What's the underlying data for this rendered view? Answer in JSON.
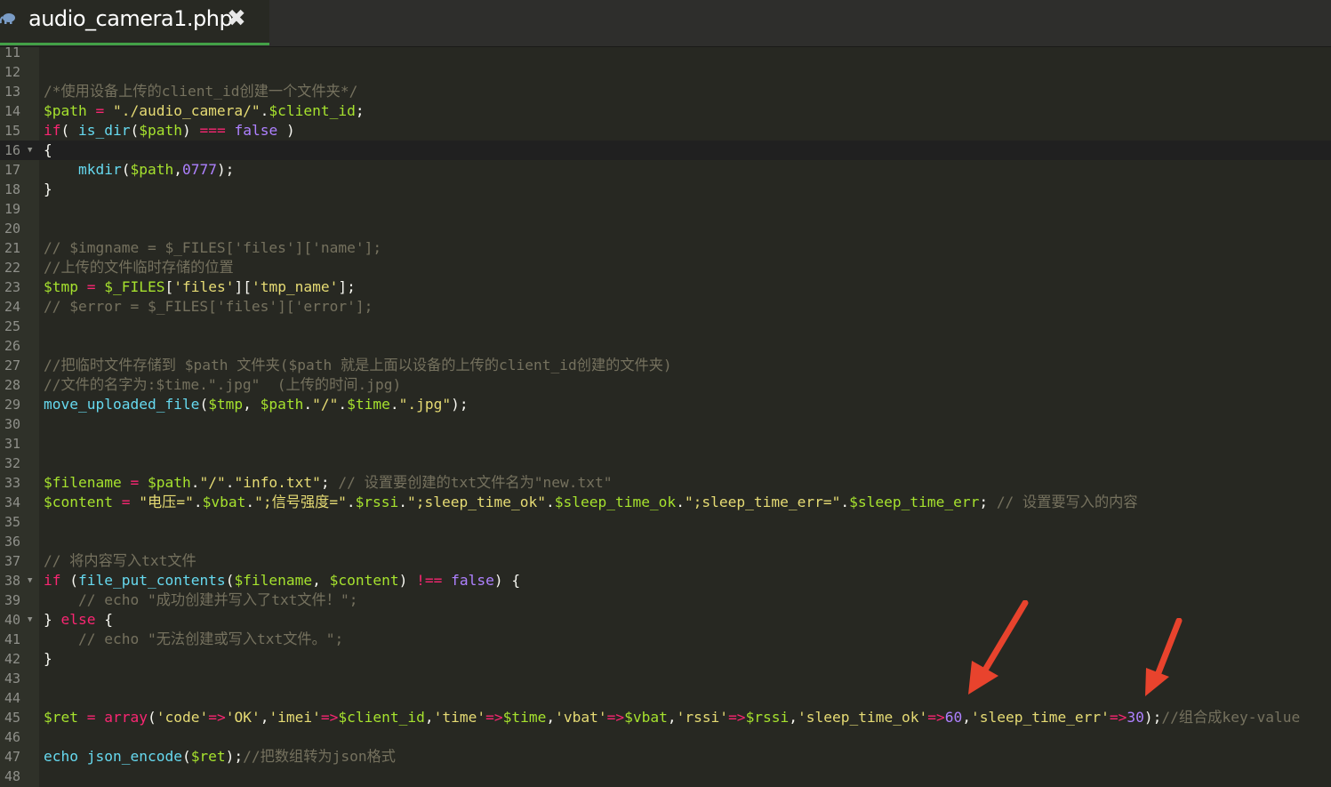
{
  "tab": {
    "title": "audio_camera1.php",
    "close_glyph": "✖",
    "icon": "php-elephant-icon"
  },
  "colors": {
    "background": "#272822",
    "gutter": "#2f3129",
    "comment": "#75715e",
    "variable": "#a6e22e",
    "string": "#e6db74",
    "keyword": "#f92672",
    "number": "#ae81ff",
    "function": "#66d9ef",
    "arrow": "#e8432d",
    "tab_underline": "#43a047"
  },
  "lines": [
    {
      "n": "11",
      "t": []
    },
    {
      "n": "12",
      "t": []
    },
    {
      "n": "13",
      "t": [
        {
          "c": "cm",
          "s": "/*使用设备上传的client_id创建一个文件夹*/"
        }
      ]
    },
    {
      "n": "14",
      "t": [
        {
          "c": "va",
          "s": "$path"
        },
        {
          "c": "pl",
          "s": " "
        },
        {
          "c": "op",
          "s": "="
        },
        {
          "c": "pl",
          "s": " "
        },
        {
          "c": "st",
          "s": "\"./audio_camera/\""
        },
        {
          "c": "pl",
          "s": "."
        },
        {
          "c": "va",
          "s": "$client_id"
        },
        {
          "c": "pl",
          "s": ";"
        }
      ]
    },
    {
      "n": "15",
      "t": [
        {
          "c": "kw",
          "s": "if"
        },
        {
          "c": "pl",
          "s": "( "
        },
        {
          "c": "fn",
          "s": "is_dir"
        },
        {
          "c": "pl",
          "s": "("
        },
        {
          "c": "va",
          "s": "$path"
        },
        {
          "c": "pl",
          "s": ") "
        },
        {
          "c": "op",
          "s": "==="
        },
        {
          "c": "pl",
          "s": " "
        },
        {
          "c": "bo",
          "s": "false"
        },
        {
          "c": "pl",
          "s": " )"
        }
      ]
    },
    {
      "n": "16",
      "fold": true,
      "active": true,
      "t": [
        {
          "c": "pl",
          "s": "{"
        }
      ]
    },
    {
      "n": "17",
      "t": [
        {
          "c": "pl",
          "s": "    "
        },
        {
          "c": "fn",
          "s": "mkdir"
        },
        {
          "c": "pl",
          "s": "("
        },
        {
          "c": "va",
          "s": "$path"
        },
        {
          "c": "pl",
          "s": ","
        },
        {
          "c": "nu",
          "s": "0777"
        },
        {
          "c": "pl",
          "s": ");"
        }
      ]
    },
    {
      "n": "18",
      "t": [
        {
          "c": "pl",
          "s": "}"
        }
      ]
    },
    {
      "n": "19",
      "t": []
    },
    {
      "n": "20",
      "t": []
    },
    {
      "n": "21",
      "t": [
        {
          "c": "cm",
          "s": "// $imgname = $_FILES['files']['name'];"
        }
      ]
    },
    {
      "n": "22",
      "t": [
        {
          "c": "cm",
          "s": "//上传的文件临时存储的位置"
        }
      ]
    },
    {
      "n": "23",
      "t": [
        {
          "c": "va",
          "s": "$tmp"
        },
        {
          "c": "pl",
          "s": " "
        },
        {
          "c": "op",
          "s": "="
        },
        {
          "c": "pl",
          "s": " "
        },
        {
          "c": "va",
          "s": "$_FILES"
        },
        {
          "c": "pl",
          "s": "["
        },
        {
          "c": "st",
          "s": "'files'"
        },
        {
          "c": "pl",
          "s": "]["
        },
        {
          "c": "st",
          "s": "'tmp_name'"
        },
        {
          "c": "pl",
          "s": "];"
        }
      ]
    },
    {
      "n": "24",
      "t": [
        {
          "c": "cm",
          "s": "// $error = $_FILES['files']['error'];"
        }
      ]
    },
    {
      "n": "25",
      "t": []
    },
    {
      "n": "26",
      "t": []
    },
    {
      "n": "27",
      "t": [
        {
          "c": "cm",
          "s": "//把临时文件存储到 $path 文件夹($path 就是上面以设备的上传的client_id创建的文件夹)"
        }
      ]
    },
    {
      "n": "28",
      "t": [
        {
          "c": "cm",
          "s": "//文件的名字为:$time.\".jpg\"  (上传的时间.jpg)"
        }
      ]
    },
    {
      "n": "29",
      "t": [
        {
          "c": "fn",
          "s": "move_uploaded_file"
        },
        {
          "c": "pl",
          "s": "("
        },
        {
          "c": "va",
          "s": "$tmp"
        },
        {
          "c": "pl",
          "s": ", "
        },
        {
          "c": "va",
          "s": "$path"
        },
        {
          "c": "pl",
          "s": "."
        },
        {
          "c": "st",
          "s": "\"/\""
        },
        {
          "c": "pl",
          "s": "."
        },
        {
          "c": "va",
          "s": "$time"
        },
        {
          "c": "pl",
          "s": "."
        },
        {
          "c": "st",
          "s": "\".jpg\""
        },
        {
          "c": "pl",
          "s": ");"
        }
      ]
    },
    {
      "n": "30",
      "t": []
    },
    {
      "n": "31",
      "t": []
    },
    {
      "n": "32",
      "t": []
    },
    {
      "n": "33",
      "t": [
        {
          "c": "va",
          "s": "$filename"
        },
        {
          "c": "pl",
          "s": " "
        },
        {
          "c": "op",
          "s": "="
        },
        {
          "c": "pl",
          "s": " "
        },
        {
          "c": "va",
          "s": "$path"
        },
        {
          "c": "pl",
          "s": "."
        },
        {
          "c": "st",
          "s": "\"/\""
        },
        {
          "c": "pl",
          "s": "."
        },
        {
          "c": "st",
          "s": "\"info.txt\""
        },
        {
          "c": "pl",
          "s": "; "
        },
        {
          "c": "cm",
          "s": "// 设置要创建的txt文件名为\"new.txt\""
        }
      ]
    },
    {
      "n": "34",
      "t": [
        {
          "c": "va",
          "s": "$content"
        },
        {
          "c": "pl",
          "s": " "
        },
        {
          "c": "op",
          "s": "="
        },
        {
          "c": "pl",
          "s": " "
        },
        {
          "c": "st",
          "s": "\"电压=\""
        },
        {
          "c": "pl",
          "s": "."
        },
        {
          "c": "va",
          "s": "$vbat"
        },
        {
          "c": "pl",
          "s": "."
        },
        {
          "c": "st",
          "s": "\";信号强度=\""
        },
        {
          "c": "pl",
          "s": "."
        },
        {
          "c": "va",
          "s": "$rssi"
        },
        {
          "c": "pl",
          "s": "."
        },
        {
          "c": "st",
          "s": "\";sleep_time_ok\""
        },
        {
          "c": "pl",
          "s": "."
        },
        {
          "c": "va",
          "s": "$sleep_time_ok"
        },
        {
          "c": "pl",
          "s": "."
        },
        {
          "c": "st",
          "s": "\";sleep_time_err=\""
        },
        {
          "c": "pl",
          "s": "."
        },
        {
          "c": "va",
          "s": "$sleep_time_err"
        },
        {
          "c": "pl",
          "s": "; "
        },
        {
          "c": "cm",
          "s": "// 设置要写入的内容"
        }
      ]
    },
    {
      "n": "35",
      "t": []
    },
    {
      "n": "36",
      "t": []
    },
    {
      "n": "37",
      "t": [
        {
          "c": "cm",
          "s": "// 将内容写入txt文件"
        }
      ]
    },
    {
      "n": "38",
      "fold": true,
      "t": [
        {
          "c": "kw",
          "s": "if"
        },
        {
          "c": "pl",
          "s": " ("
        },
        {
          "c": "fn",
          "s": "file_put_contents"
        },
        {
          "c": "pl",
          "s": "("
        },
        {
          "c": "va",
          "s": "$filename"
        },
        {
          "c": "pl",
          "s": ", "
        },
        {
          "c": "va",
          "s": "$content"
        },
        {
          "c": "pl",
          "s": ") "
        },
        {
          "c": "op",
          "s": "!=="
        },
        {
          "c": "pl",
          "s": " "
        },
        {
          "c": "bo",
          "s": "false"
        },
        {
          "c": "pl",
          "s": ") {"
        }
      ]
    },
    {
      "n": "39",
      "t": [
        {
          "c": "pl",
          "s": "    "
        },
        {
          "c": "cm",
          "s": "// echo \"成功创建并写入了txt文件！\";"
        }
      ]
    },
    {
      "n": "40",
      "fold": true,
      "t": [
        {
          "c": "pl",
          "s": "} "
        },
        {
          "c": "kw",
          "s": "else"
        },
        {
          "c": "pl",
          "s": " {"
        }
      ]
    },
    {
      "n": "41",
      "t": [
        {
          "c": "pl",
          "s": "    "
        },
        {
          "c": "cm",
          "s": "// echo \"无法创建或写入txt文件。\";"
        }
      ]
    },
    {
      "n": "42",
      "t": [
        {
          "c": "pl",
          "s": "}"
        }
      ]
    },
    {
      "n": "43",
      "t": []
    },
    {
      "n": "44",
      "t": []
    },
    {
      "n": "45",
      "t": [
        {
          "c": "va",
          "s": "$ret"
        },
        {
          "c": "pl",
          "s": " "
        },
        {
          "c": "op",
          "s": "="
        },
        {
          "c": "pl",
          "s": " "
        },
        {
          "c": "kw",
          "s": "array"
        },
        {
          "c": "pl",
          "s": "("
        },
        {
          "c": "st",
          "s": "'code'"
        },
        {
          "c": "op",
          "s": "=>"
        },
        {
          "c": "st",
          "s": "'OK'"
        },
        {
          "c": "pl",
          "s": ","
        },
        {
          "c": "st",
          "s": "'imei'"
        },
        {
          "c": "op",
          "s": "=>"
        },
        {
          "c": "va",
          "s": "$client_id"
        },
        {
          "c": "pl",
          "s": ","
        },
        {
          "c": "st",
          "s": "'time'"
        },
        {
          "c": "op",
          "s": "=>"
        },
        {
          "c": "va",
          "s": "$time"
        },
        {
          "c": "pl",
          "s": ","
        },
        {
          "c": "st",
          "s": "'vbat'"
        },
        {
          "c": "op",
          "s": "=>"
        },
        {
          "c": "va",
          "s": "$vbat"
        },
        {
          "c": "pl",
          "s": ","
        },
        {
          "c": "st",
          "s": "'rssi'"
        },
        {
          "c": "op",
          "s": "=>"
        },
        {
          "c": "va",
          "s": "$rssi"
        },
        {
          "c": "pl",
          "s": ","
        },
        {
          "c": "st",
          "s": "'sleep_time_ok'"
        },
        {
          "c": "op",
          "s": "=>"
        },
        {
          "c": "nu",
          "s": "60"
        },
        {
          "c": "pl",
          "s": ","
        },
        {
          "c": "st",
          "s": "'sleep_time_err'"
        },
        {
          "c": "op",
          "s": "=>"
        },
        {
          "c": "nu",
          "s": "30"
        },
        {
          "c": "pl",
          "s": ");"
        },
        {
          "c": "cm",
          "s": "//组合成key-value"
        }
      ]
    },
    {
      "n": "46",
      "t": []
    },
    {
      "n": "47",
      "t": [
        {
          "c": "fn",
          "s": "echo"
        },
        {
          "c": "pl",
          "s": " "
        },
        {
          "c": "fn",
          "s": "json_encode"
        },
        {
          "c": "pl",
          "s": "("
        },
        {
          "c": "va",
          "s": "$ret"
        },
        {
          "c": "pl",
          "s": ");"
        },
        {
          "c": "cm",
          "s": "//把数组转为json格式"
        }
      ]
    },
    {
      "n": "48",
      "t": []
    },
    {
      "n": "",
      "t": [
        {
          "c": "pl",
          "s": "?"
        }
      ]
    }
  ]
}
